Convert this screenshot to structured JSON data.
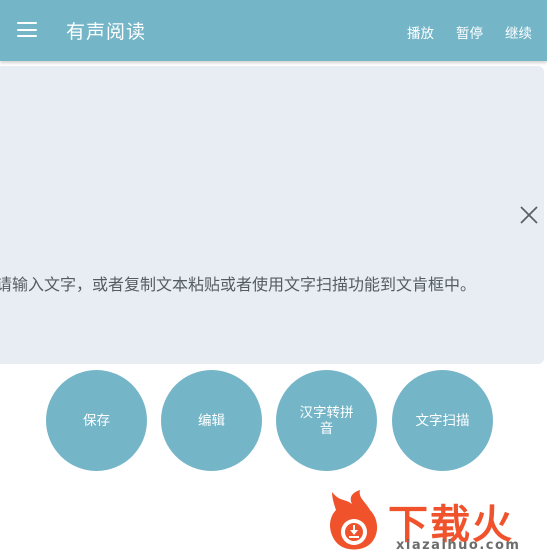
{
  "appbar": {
    "title": "有声阅读",
    "actions": {
      "play": "播放",
      "pause": "暂停",
      "resume": "继续"
    }
  },
  "text_area": {
    "content": "请输入文字，或者复制文本粘贴或者使用文字扫描功能到文肯框中。"
  },
  "buttons": {
    "save": "保存",
    "edit": "编辑",
    "pinyin": "汉字转拼音",
    "scan": "文字扫描"
  },
  "watermark": {
    "brand": "下载火",
    "url": "xiazaihuo.com"
  },
  "colors": {
    "accent": "#74b5c8",
    "card_background": "#e8edf4",
    "watermark": "#f0532c"
  },
  "icons": {
    "menu": "menu-icon",
    "clear": "close-icon",
    "logo": "flame-logo-icon"
  }
}
